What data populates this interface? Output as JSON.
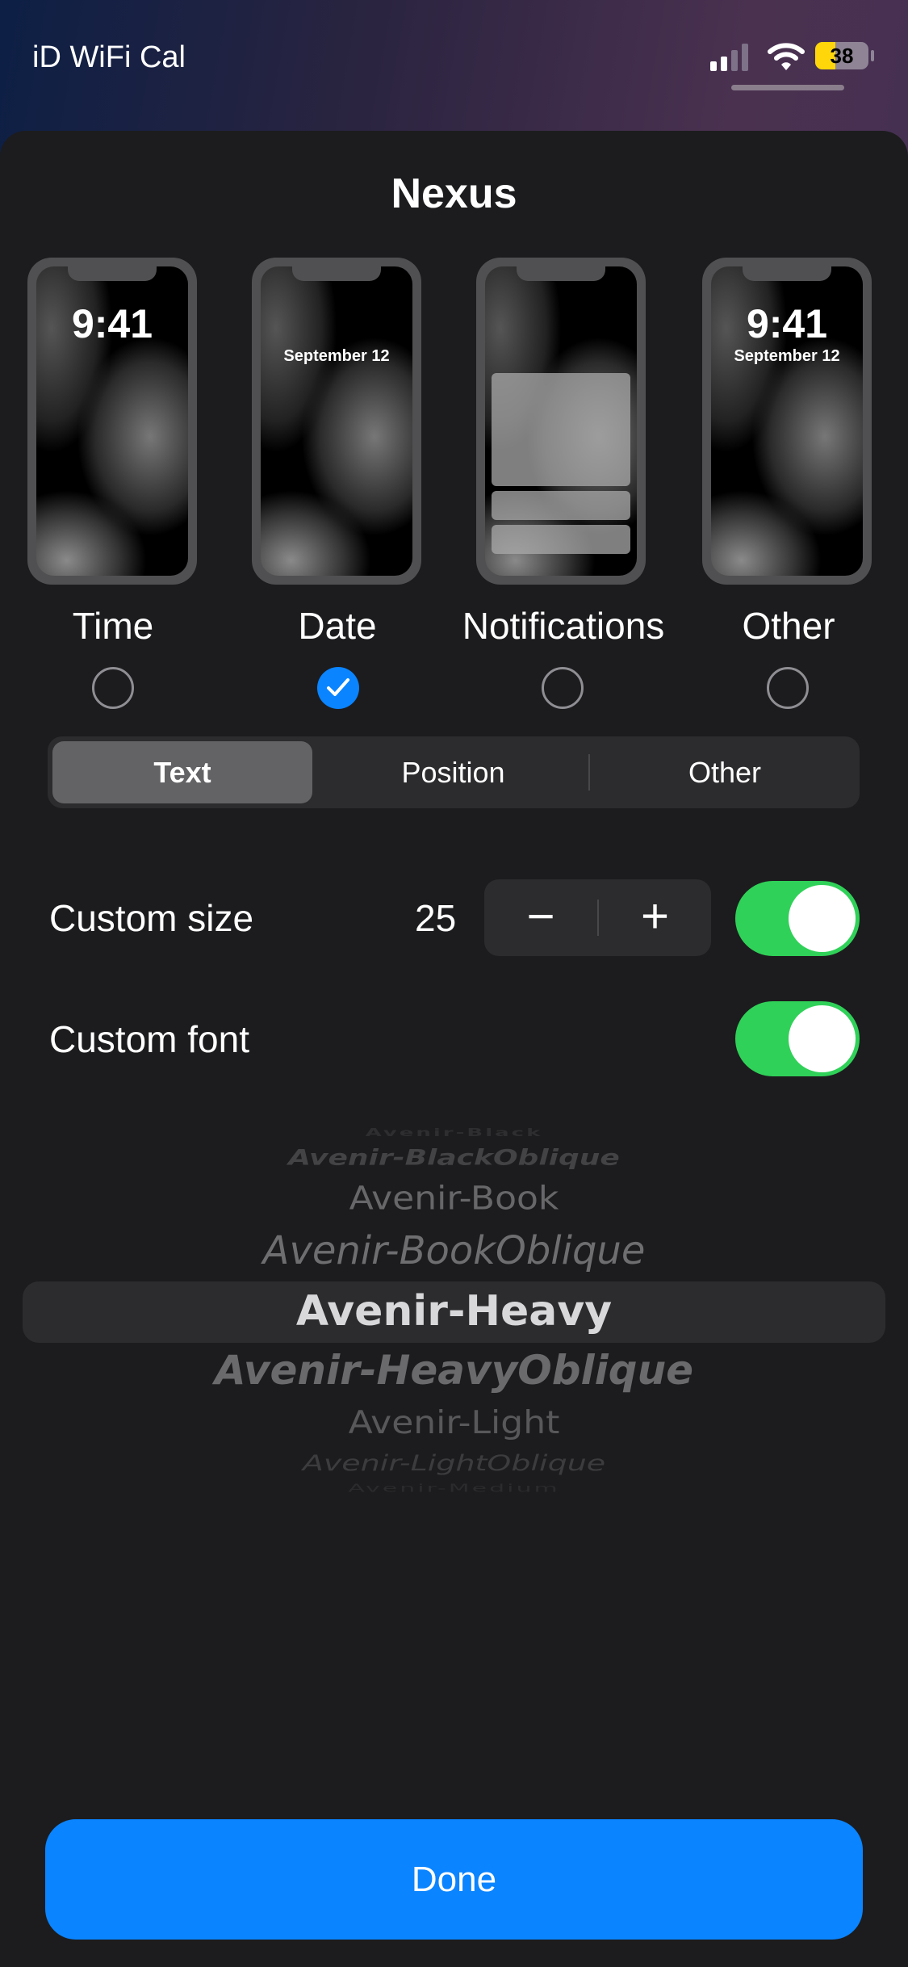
{
  "status_bar": {
    "carrier": "iD WiFi Cal",
    "battery": "38"
  },
  "sheet": {
    "title": "Nexus"
  },
  "previews": [
    {
      "label": "Time",
      "time": "9:41",
      "selected": false
    },
    {
      "label": "Date",
      "date": "September 12",
      "selected": true
    },
    {
      "label": "Notifications",
      "selected": false
    },
    {
      "label": "Other",
      "time": "9:41",
      "date": "September 12",
      "selected": false
    }
  ],
  "segments": {
    "items": [
      "Text",
      "Position",
      "Other"
    ],
    "selected": "Text"
  },
  "custom_size": {
    "label": "Custom size",
    "value": "25",
    "minus": "−",
    "plus": "+",
    "enabled": true
  },
  "custom_font": {
    "label": "Custom font",
    "enabled": true
  },
  "font_picker": {
    "items": [
      "Avenir-Black",
      "Avenir-BlackOblique",
      "Avenir-Book",
      "Avenir-BookOblique",
      "Avenir-Heavy",
      "Avenir-HeavyOblique",
      "Avenir-Light",
      "Avenir-LightOblique",
      "Avenir-Medium"
    ],
    "selected": "Avenir-Heavy"
  },
  "done_label": "Done",
  "colors": {
    "accent": "#0a84ff",
    "toggle_on": "#30d158",
    "background": "#1c1c1e"
  }
}
